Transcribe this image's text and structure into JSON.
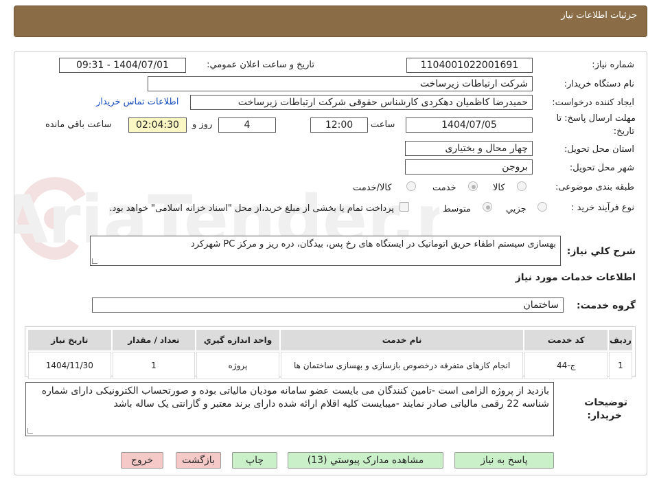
{
  "header": {
    "title": "جزئیات اطلاعات نیاز"
  },
  "form": {
    "need_number_label": "شماره نیاز:",
    "need_number": "1104001022001691",
    "announce_label": "تاریخ و ساعت اعلان عمومي:",
    "announce_value": "1404/07/01 - 09:31",
    "buyer_org_label": "نام دستگاه خريدار:",
    "buyer_org": "شرکت ارتباطات زیرساخت",
    "requester_label": "ايجاد کننده درخواست:",
    "requester": "حمیدرضا کاظمیان دهکردی کارشناس حقوقی شرکت ارتباطات زیرساخت",
    "contact_link": "اطلاعات تماس خريدار",
    "deadline_label_1": "مهلت ارسال پاسخ: تا",
    "deadline_label_2": "تاريخ:",
    "deadline_date": "1404/07/05",
    "time_label": "ساعت",
    "deadline_time": "12:00",
    "days_value": "4",
    "days_label": "روز و",
    "remaining_time": "02:04:30",
    "remaining_label": "ساعت باقي مانده",
    "province_label": "استان محل تحويل:",
    "province": "چهار محال و بختیاری",
    "city_label": "شهر محل تحويل:",
    "city": "بروجن",
    "category_label": "طبقه بندی موضوعی:",
    "category_options": [
      "کالا",
      "خدمت",
      "کالا/خدمت"
    ],
    "category_selected": "خدمت",
    "process_label": "نوع فرآیند خرید :",
    "process_options": [
      "جزيي",
      "متوسط"
    ],
    "process_selected": "متوسط",
    "payment_note": "پرداخت تمام یا بخشی از مبلغ خرید،از محل \"اسناد خزانه اسلامی\" خواهد بود."
  },
  "description": {
    "label": "شرح كلي نياز:",
    "value": "بهسازی سیستم اطفاء حریق اتوماتیک در ایستگاه های رخ پس، بیدگان، دره ریز و مرکز PC شهرکرد"
  },
  "services": {
    "section_title": "اطلاعات خدمات مورد نياز",
    "group_label": "گروه خدمت:",
    "group_value": "ساختمان",
    "columns": [
      "رديف",
      "کد خدمت",
      "نام خدمت",
      "واحد اندازه گيري",
      "تعداد / مقدار",
      "تاريخ نياز"
    ],
    "rows": [
      [
        "1",
        "ج-44",
        "انجام کارهای متفرقه درخصوص بازسازی و بهسازی ساختمان ها",
        "پروژه",
        "1",
        "1404/11/30"
      ]
    ]
  },
  "buyer_notes": {
    "label_1": "توضيحات",
    "label_2": "خريدار:",
    "value": "بازدید از پروژه الزامی است -تامین کنندگان می بایست عضو سامانه مودیان مالیاتی بوده و صورتحساب الکترونیکی دارای شماره شناسه 22 رقمی مالیاتی صادر نمایند -میبایست کلیه اقلام ارائه شده دارای برند معتبر و  گارانتی  یک ساله باشد"
  },
  "buttons": {
    "reply": "پاسخ به نياز",
    "attachments": "مشاهده مدارک پيوستي (13)",
    "print": "چاپ",
    "back": "بازگشت",
    "exit": "خروج"
  },
  "colors": {
    "header_bg": "#8a6d47",
    "green_button": "#c9f0c9",
    "pink_button": "#f6c9c9",
    "yellow_field": "#fbf7c4"
  }
}
